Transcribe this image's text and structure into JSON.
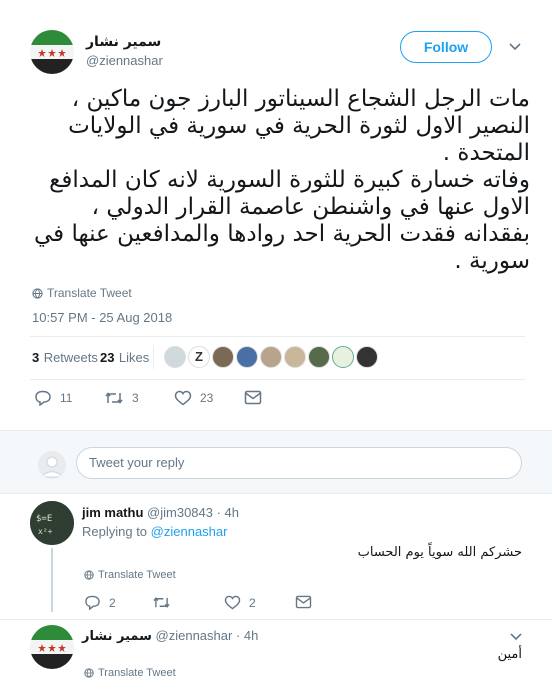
{
  "tweet": {
    "author_name": "سمير نشار",
    "author_handle": "@ziennashar",
    "follow_label": "Follow",
    "body": "مات الرجل الشجاع السيناتور البارز جون ماكين ،\nالنصير الاول لثورة الحرية في سورية في الولايات المتحدة .\nوفاته خسارة كبيرة للثورة السورية لانه كان المدافع الاول عنها في واشنطن عاصمة القرار الدولي ،\nبفقدانه فقدت الحرية احد روادها والمدافعين عنها في سورية .",
    "translate_label": "Translate Tweet",
    "timestamp": "10:57 PM - 25 Aug 2018",
    "retweets_count": "3",
    "retweets_label": "Retweets",
    "likes_count": "23",
    "likes_label": "Likes",
    "actions": {
      "reply_count": "11",
      "retweet_count": "3",
      "like_count": "23"
    }
  },
  "reply_composer": {
    "placeholder": "Tweet your reply"
  },
  "replies": [
    {
      "name": "jim mathu",
      "handle": "@jim30843",
      "age": "· 4h",
      "replying_prefix": "Replying to",
      "replying_to": "@ziennashar",
      "text": "حشركم الله سوياً يوم الحساب",
      "translate_label": "Translate Tweet",
      "reply_count": "2",
      "like_count": "2"
    },
    {
      "name": "سمير نشار",
      "handle": "@ziennashar",
      "age": "· 4h",
      "text": "أمين",
      "translate_label": "Translate Tweet"
    }
  ],
  "colors": {
    "accent": "#1da1f2",
    "muted": "#657786",
    "border": "#e6ecf0",
    "like": "#e0245e"
  }
}
